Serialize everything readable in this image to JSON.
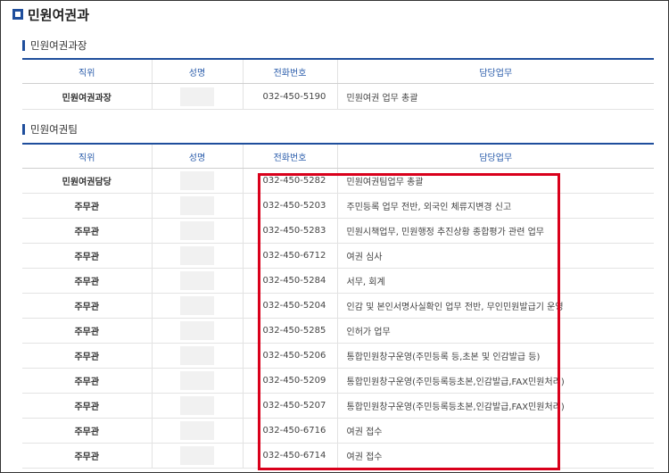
{
  "page_title": "민원여권과",
  "section1": {
    "heading": "민원여권과장",
    "headers": [
      "직위",
      "성명",
      "전화번호",
      "담당업무"
    ],
    "rows": [
      {
        "position": "민원여권과장",
        "phone": "032-450-5190",
        "duty": "민원여권 업무 총괄"
      }
    ]
  },
  "section2": {
    "heading": "민원여권팀",
    "headers": [
      "직위",
      "성명",
      "전화번호",
      "담당업무"
    ],
    "rows": [
      {
        "position": "민원여권담당",
        "phone": "032-450-5282",
        "duty": "민원여권팀업무 총괄"
      },
      {
        "position": "주무관",
        "phone": "032-450-5203",
        "duty": "주민등록 업무 전반, 외국인 체류지변경 신고"
      },
      {
        "position": "주무관",
        "phone": "032-450-5283",
        "duty": "민원시책업무, 민원행정 추진상황 종합평가 관련 업무"
      },
      {
        "position": "주무관",
        "phone": "032-450-6712",
        "duty": "여권 심사"
      },
      {
        "position": "주무관",
        "phone": "032-450-5284",
        "duty": "서무, 회계"
      },
      {
        "position": "주무관",
        "phone": "032-450-5204",
        "duty": "인감 및 본인서명사실확인 업무 전반, 무인민원발급기 운영"
      },
      {
        "position": "주무관",
        "phone": "032-450-5285",
        "duty": "인허가 업무"
      },
      {
        "position": "주무관",
        "phone": "032-450-5206",
        "duty": "통합민원창구운영(주민등록 등,초본 및 인감발급 등)"
      },
      {
        "position": "주무관",
        "phone": "032-450-5209",
        "duty": "통합민원창구운영(주민등록등초본,인감발급,FAX민원처리)"
      },
      {
        "position": "주무관",
        "phone": "032-450-5207",
        "duty": "통합민원창구운영(주민등록등초본,인감발급,FAX민원처리)"
      },
      {
        "position": "주무관",
        "phone": "032-450-6716",
        "duty": "여권 접수"
      },
      {
        "position": "주무관",
        "phone": "032-450-6714",
        "duty": "여권 접수"
      }
    ]
  },
  "colors": {
    "accent": "#1f4e9c",
    "header_text": "#2b5dab",
    "highlight": "#d9001b"
  }
}
